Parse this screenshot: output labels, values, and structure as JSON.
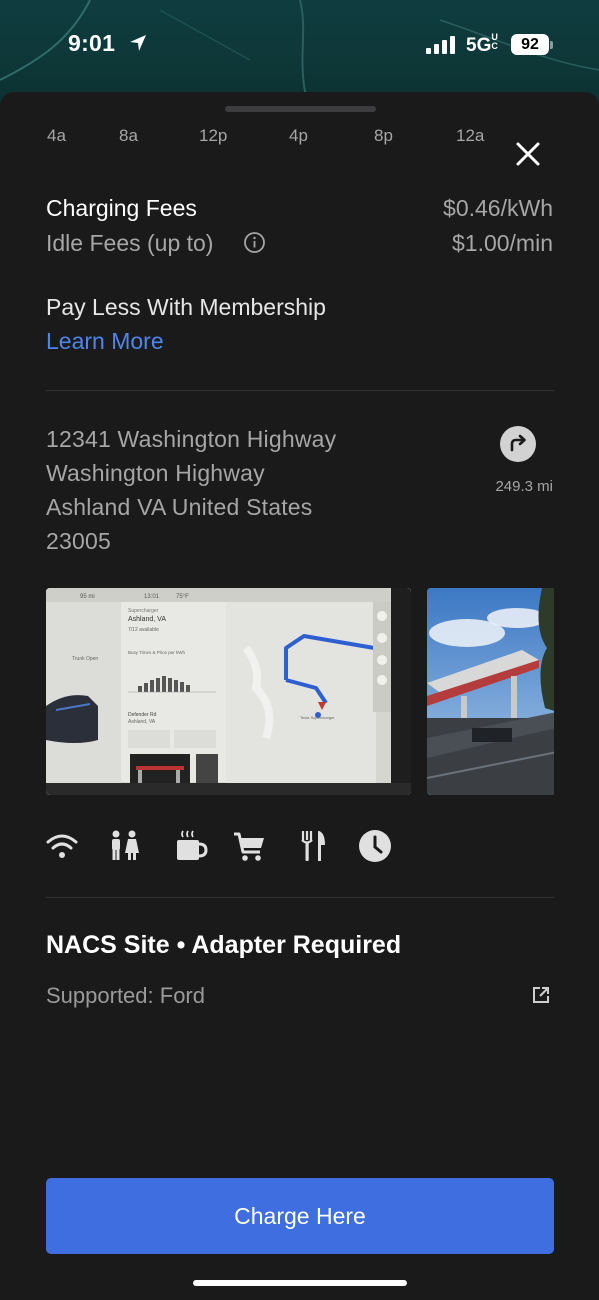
{
  "status_bar": {
    "time": "9:01",
    "network": "5G",
    "network_suffix": "UC",
    "battery": "92"
  },
  "hours": [
    "4a",
    "8a",
    "12p",
    "4p",
    "8p",
    "12a"
  ],
  "fees": {
    "charging_label": "Charging Fees",
    "charging_value": "$0.46/kWh",
    "idle_label": "Idle Fees (up to)",
    "idle_value": "$1.00/min"
  },
  "membership": {
    "title": "Pay Less With Membership",
    "link": "Learn More"
  },
  "address": {
    "lines": [
      "12341 Washington Highway",
      "Washington Highway",
      "Ashland VA United States",
      "23005"
    ],
    "distance": "249.3 mi"
  },
  "photo_screen": {
    "range": "95 mi",
    "clock": "13:01",
    "temp": "75°F",
    "site_kind": "Supercharger",
    "site_name": "Ashland, VA",
    "chargers": "7/12 available",
    "busy_label": "Busy Times & Price per kWh",
    "destination_label": "Defender Rd",
    "destination_city": "Ashland, VA",
    "trunk_label": "Trunk Open",
    "map_label": "Tesla Supercharger"
  },
  "amenities": [
    "wifi-icon",
    "restroom-icon",
    "coffee-icon",
    "shopping-cart-icon",
    "dining-icon",
    "clock-icon"
  ],
  "nacs": {
    "title": "NACS Site • Adapter Required",
    "supported": "Supported: Ford"
  },
  "cta": {
    "label": "Charge Here"
  },
  "colors": {
    "accent": "#3e6ee0",
    "link": "#4e86ea",
    "background": "#1a1a1b"
  }
}
